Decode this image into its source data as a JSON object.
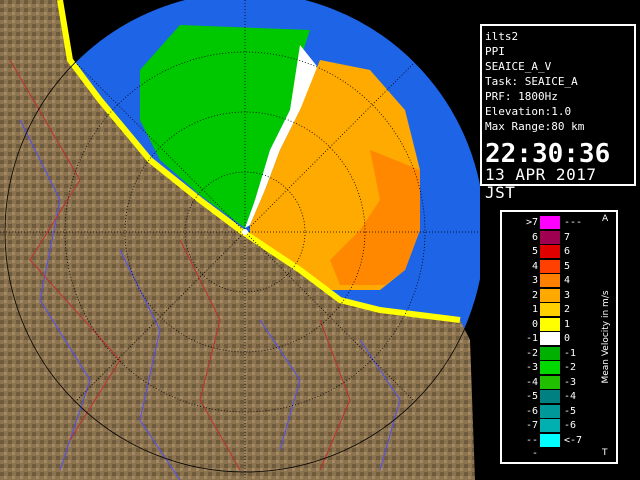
{
  "info": {
    "station": "ilts2",
    "mode": "PPI",
    "product": "SEAICE_A_V",
    "task": "Task: SEAICE_A",
    "prf": "PRF: 1800Hz",
    "elevation": "Elevation:1.0",
    "max_range": "Max Range:80 km",
    "time": "22:30:36",
    "date": "13 APR 2017 JST"
  },
  "legend": {
    "title": "Mean Velocity in m/s",
    "mark_top": "A",
    "mark_bottom": "T",
    "rows": [
      {
        "left": ">7",
        "right": "---",
        "color": "#ff00ff"
      },
      {
        "left": "6",
        "right": "7",
        "color": "#a00050"
      },
      {
        "left": "5",
        "right": "6",
        "color": "#e00000"
      },
      {
        "left": "4",
        "right": "5",
        "color": "#ff4000"
      },
      {
        "left": "3",
        "right": "4",
        "color": "#ff8000"
      },
      {
        "left": "2",
        "right": "3",
        "color": "#ffa800"
      },
      {
        "left": "1",
        "right": "2",
        "color": "#ffd000"
      },
      {
        "left": "0",
        "right": "1",
        "color": "#ffff00"
      },
      {
        "left": "-1",
        "right": "0",
        "color": "#ffffff"
      },
      {
        "left": "-2",
        "right": "-1",
        "color": "#00b000"
      },
      {
        "left": "-3",
        "right": "-2",
        "color": "#00d800"
      },
      {
        "left": "-4",
        "right": "-3",
        "color": "#20c000"
      },
      {
        "left": "-5",
        "right": "-4",
        "color": "#008080"
      },
      {
        "left": "-6",
        "right": "-5",
        "color": "#009898"
      },
      {
        "left": "-7",
        "right": "-6",
        "color": "#00b0b0"
      },
      {
        "left": "---",
        "right": "<-7",
        "color": "#00ffff"
      }
    ]
  },
  "map": {
    "sea_color": "#1e64e6",
    "land_color": "#8c7350",
    "coast_echo_color": "#ffff00"
  }
}
